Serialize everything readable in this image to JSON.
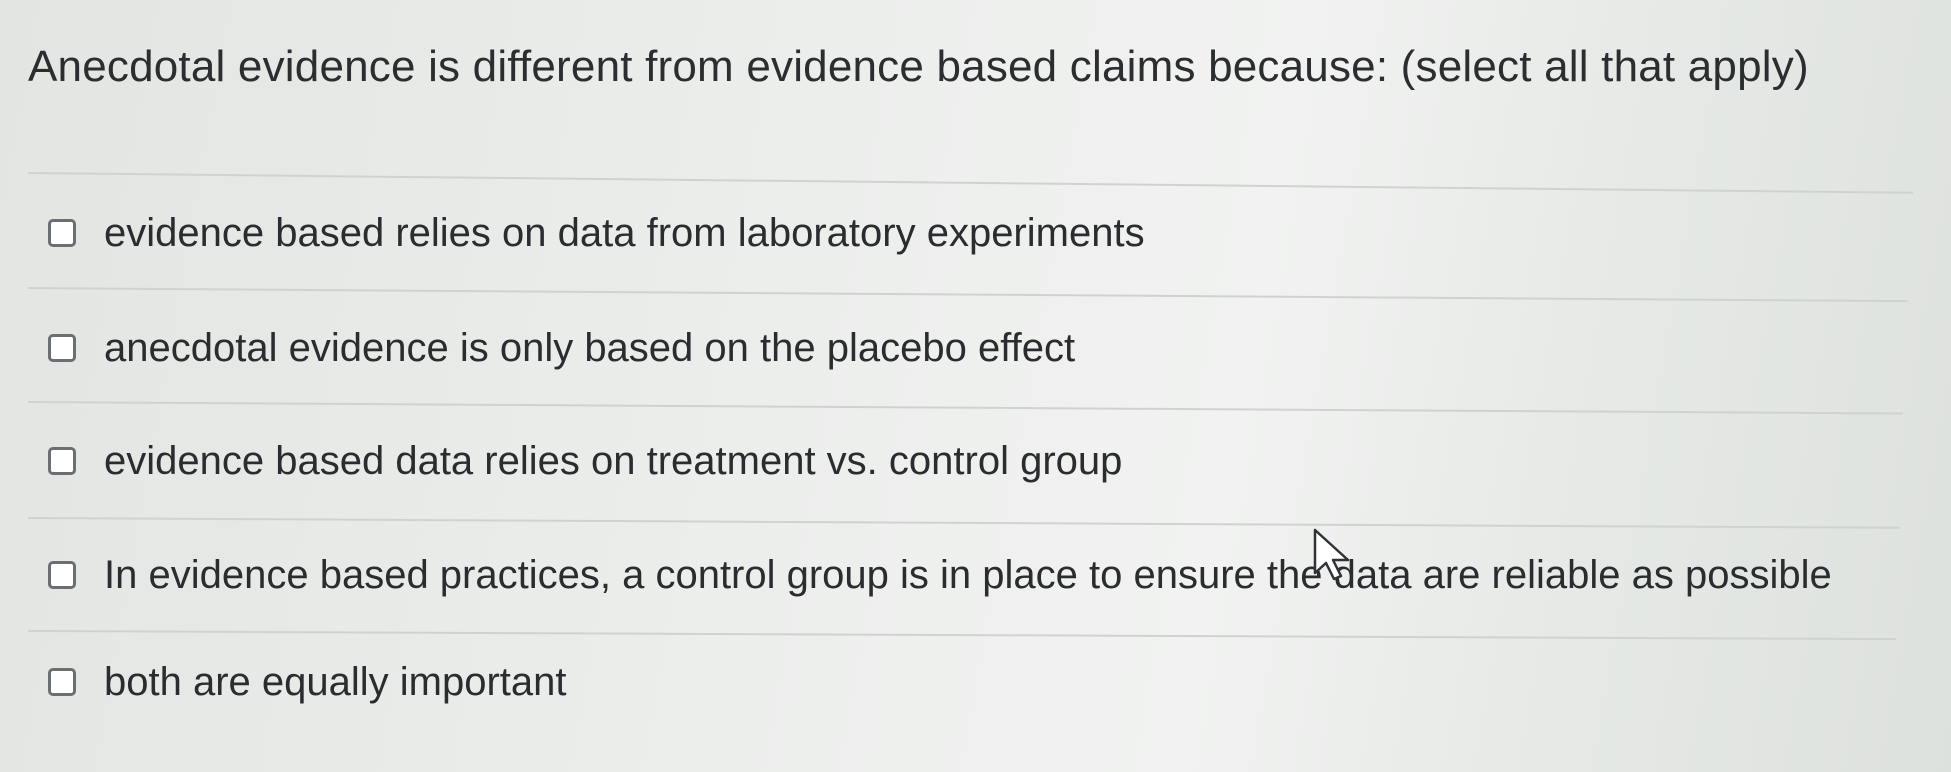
{
  "question": {
    "text": "Anecdotal evidence is different from evidence based claims because: (select all that apply)"
  },
  "options": [
    {
      "label": "evidence based relies on data from laboratory experiments",
      "checked": false
    },
    {
      "label": "anecdotal evidence is only based on the placebo effect",
      "checked": false
    },
    {
      "label": "evidence based data relies on treatment vs. control group",
      "checked": false
    },
    {
      "label": "In evidence based practices, a control group is in place to ensure the data are reliable as possible",
      "checked": false
    },
    {
      "label": "both are equally important",
      "checked": false
    }
  ],
  "colors": {
    "text": "#2a2d2f",
    "divider": "#cfd3d0",
    "checkbox_border": "#6a6f73"
  },
  "icons": {
    "cursor": "mouse-pointer-icon",
    "checkbox": "checkbox-icon"
  }
}
